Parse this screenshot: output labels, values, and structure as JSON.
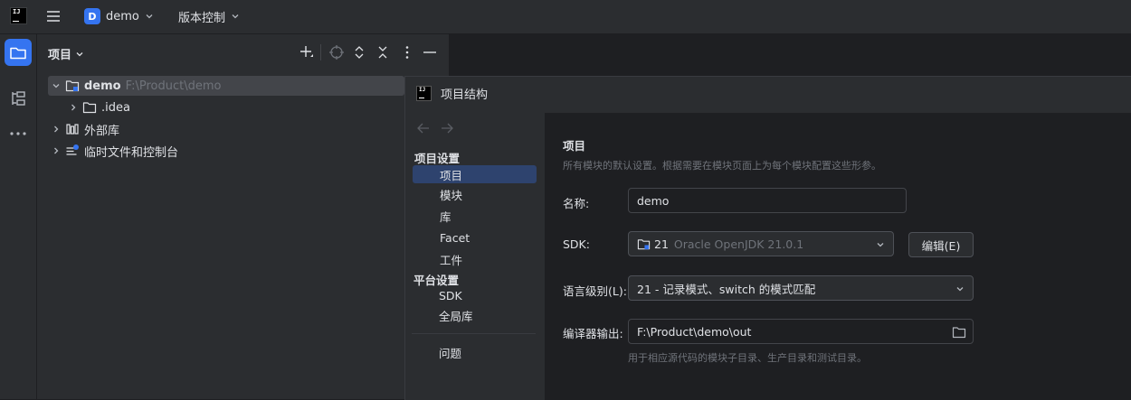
{
  "titlebar": {
    "logo_text": "IJ",
    "project_badge": "D",
    "project_name": "demo",
    "vcs_label": "版本控制"
  },
  "project_panel": {
    "title": "项目",
    "tree": {
      "root_name": "demo",
      "root_path": "F:\\Product\\demo",
      "idea_folder": ".idea",
      "external_libs": "外部库",
      "scratches": "临时文件和控制台"
    }
  },
  "dialog": {
    "title": "项目结构",
    "sidebar": {
      "section_project": "项目设置",
      "items_project": [
        "项目",
        "模块",
        "库",
        "Facet",
        "工件"
      ],
      "section_platform": "平台设置",
      "items_platform": [
        "SDK",
        "全局库"
      ],
      "problems": "问题",
      "selected": "项目"
    },
    "content": {
      "heading": "项目",
      "description": "所有模块的默认设置。根据需要在模块页面上为每个模块配置这些形参。",
      "name_label": "名称:",
      "name_value": "demo",
      "sdk_label": "SDK:",
      "sdk_version": "21",
      "sdk_name": "Oracle OpenJDK 21.0.1",
      "edit_button": "编辑(E)",
      "language_label": "语言级别(L):",
      "language_value": "21 - 记录模式、switch 的模式匹配",
      "compiler_label": "编译器输出:",
      "compiler_value": "F:\\Product\\demo\\out",
      "compiler_hint": "用于相应源代码的模块子目录、生产目录和测试目录。"
    }
  },
  "colors": {
    "accent": "#3574f0",
    "selection": "#2e436e",
    "tree_selection": "#43454a",
    "background": "#1e1f22",
    "panel": "#2b2d30"
  }
}
